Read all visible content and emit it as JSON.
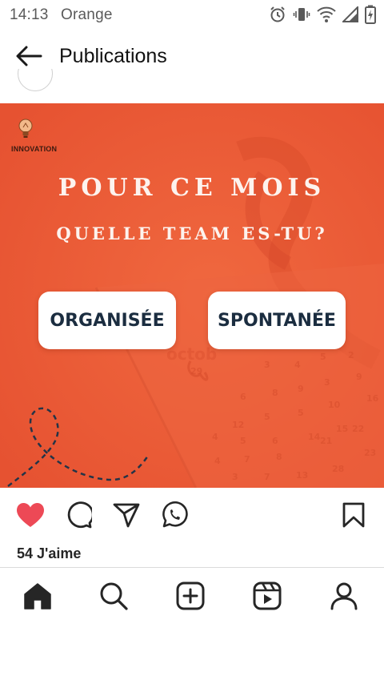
{
  "status_bar": {
    "time": "14:13",
    "carrier": "Orange",
    "icons": [
      "alarm-icon",
      "vibrate-icon",
      "wifi-icon",
      "signal-icon",
      "battery-charging-icon"
    ]
  },
  "header": {
    "back_icon": "arrow-left-icon",
    "title": "Publications"
  },
  "post": {
    "brand": "INNOVATION",
    "headline": "POUR CE MOIS",
    "subheadline": "QUELLE TEAM ES-TU?",
    "option_left": "ORGANISÉE",
    "option_right": "SPONTANÉE",
    "background_color": "#ea5a35",
    "liked": true,
    "like_color": "#ed4956",
    "likes_text": "54 J'aime"
  },
  "actions": {
    "icons": [
      "heart-icon",
      "comment-icon",
      "share-icon",
      "whatsapp-icon",
      "bookmark-icon"
    ]
  },
  "bottom_nav": {
    "items": [
      "home-icon",
      "search-icon",
      "create-icon",
      "reels-icon",
      "profile-icon"
    ]
  }
}
